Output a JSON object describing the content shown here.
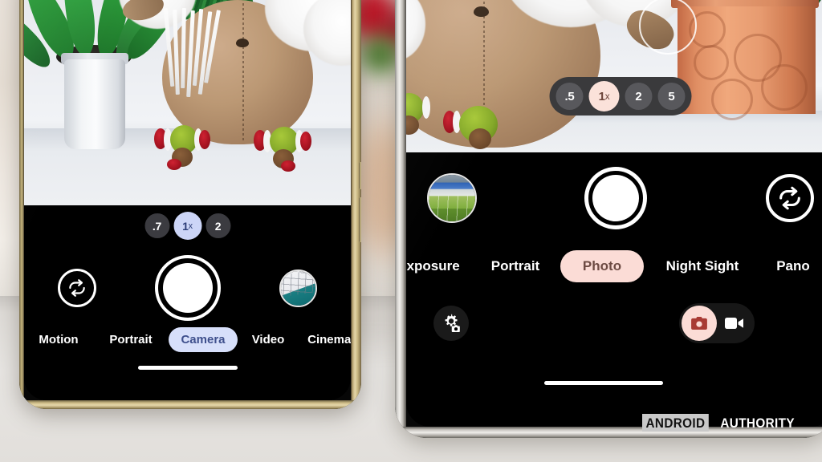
{
  "scene": {
    "description": "Two Android phones side by side showing camera apps pointed at a Christmas reindeer plush toy",
    "watermark": {
      "part1": "ANDROID",
      "part2": "AUTHORITY"
    }
  },
  "left_phone": {
    "frame_color": "#cdbb86",
    "frame_name": "gold-frame",
    "preview": {
      "subject": "christmas-reindeer-plush",
      "props": [
        "green-plant-white-pot",
        "shelf"
      ]
    },
    "zoom_bar": {
      "name": "zoom-level-selector",
      "options": [
        {
          "label": ".7",
          "selected": false
        },
        {
          "label": "1",
          "suffix": "x",
          "selected": true
        },
        {
          "label": "2",
          "selected": false
        }
      ],
      "selected_color": "#ccd5f7",
      "selected_text_color": "#2b3c77",
      "pill_bg": "#3b3b40"
    },
    "controls": {
      "flip_camera_label": "flip-camera",
      "shutter_label": "shutter",
      "gallery_thumbnail": "keyboard-photo"
    },
    "modes": {
      "name": "camera-mode-carousel",
      "items": [
        {
          "label": "Motion",
          "selected": false
        },
        {
          "label": "Portrait",
          "selected": false
        },
        {
          "label": "Camera",
          "selected": true
        },
        {
          "label": "Video",
          "selected": false
        },
        {
          "label": "Cinematic",
          "selected": false,
          "clipped": true
        }
      ],
      "selected_pill_color": "#d7dffa",
      "selected_text_color": "#3e4f8c"
    },
    "nav_gesture_bar": true
  },
  "right_phone": {
    "frame_color": "#e4e2de",
    "frame_name": "silver-frame",
    "preview": {
      "subject": "christmas-reindeer-plush",
      "props": [
        "terracotta-pot-succulent",
        "shelf"
      ],
      "focus_ring": true
    },
    "zoom_bar": {
      "name": "zoom-level-selector",
      "options": [
        {
          "label": ".5",
          "selected": false
        },
        {
          "label": "1",
          "suffix": "x",
          "selected": true
        },
        {
          "label": "2",
          "selected": false
        },
        {
          "label": "5",
          "selected": false
        }
      ],
      "selected_color": "#fbe2da",
      "selected_text_color": "#6b4338",
      "pill_bg": "#3f3f42",
      "bar_bg": "#3a3a3c"
    },
    "controls": {
      "gallery_thumbnail": "sports-field-photo",
      "shutter_label": "shutter",
      "flip_camera_label": "flip-camera"
    },
    "modes": {
      "name": "camera-mode-carousel",
      "items": [
        {
          "label": "Exposure",
          "selected": false,
          "clipped": true
        },
        {
          "label": "Portrait",
          "selected": false
        },
        {
          "label": "Photo",
          "selected": true
        },
        {
          "label": "Night Sight",
          "selected": false
        },
        {
          "label": "Pano",
          "selected": false,
          "clipped": true
        }
      ],
      "selected_pill_color": "#fbdcd6",
      "selected_text_color": "#6d4b43"
    },
    "bottom_row": {
      "settings_label": "camera-settings",
      "photo_video_toggle": {
        "options": [
          {
            "label": "Photo",
            "icon": "camera-icon",
            "selected": true
          },
          {
            "label": "Video",
            "icon": "video-camera-icon",
            "selected": false
          }
        ],
        "active_color": "#fbdcd6",
        "active_icon_color": "#a83b34"
      }
    },
    "nav_gesture_bar": true
  }
}
